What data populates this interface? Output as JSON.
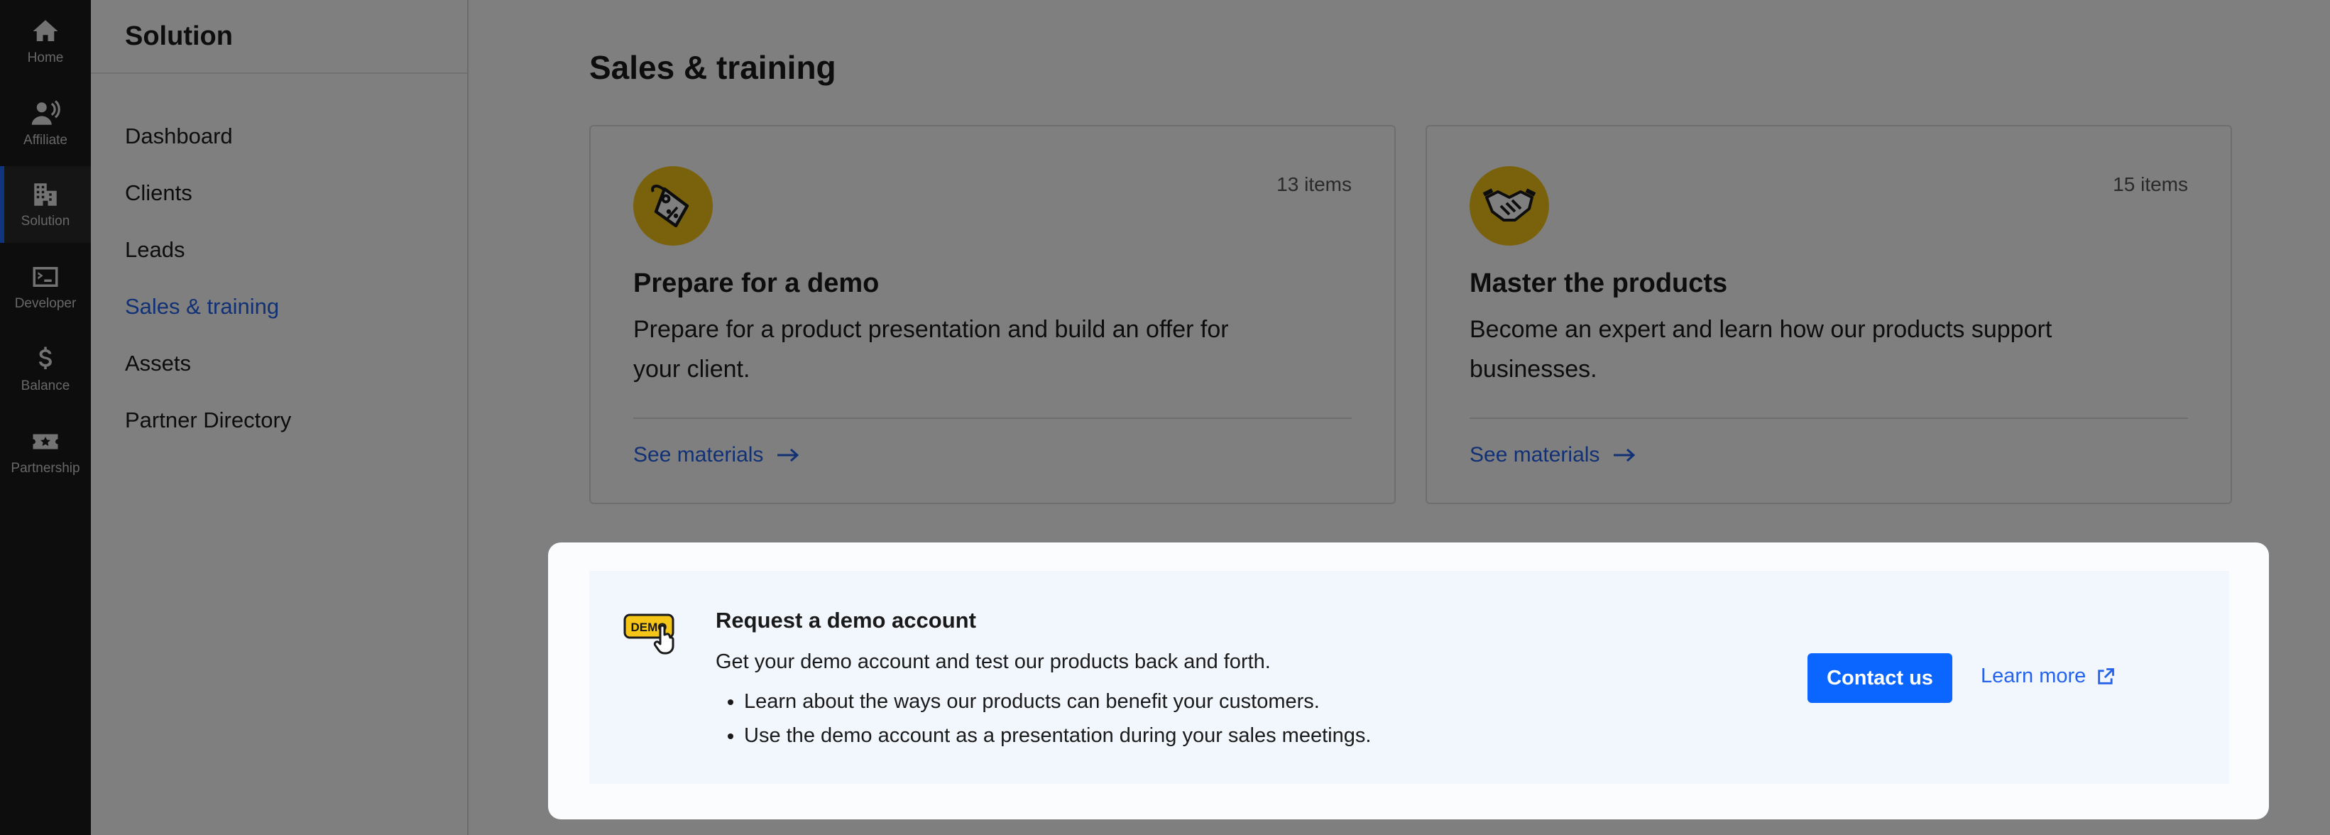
{
  "rail": {
    "items": [
      {
        "label": "Home",
        "icon": "home-icon"
      },
      {
        "label": "Affiliate",
        "icon": "affiliate-icon"
      },
      {
        "label": "Solution",
        "icon": "building-icon",
        "active": true
      },
      {
        "label": "Developer",
        "icon": "terminal-icon"
      },
      {
        "label": "Balance",
        "icon": "dollar-icon"
      },
      {
        "label": "Partnership",
        "icon": "ticket-icon"
      }
    ]
  },
  "sidebar": {
    "title": "Solution",
    "items": [
      {
        "label": "Dashboard"
      },
      {
        "label": "Clients"
      },
      {
        "label": "Leads"
      },
      {
        "label": "Sales & training",
        "active": true
      },
      {
        "label": "Assets"
      },
      {
        "label": "Partner Directory"
      }
    ]
  },
  "main": {
    "title": "Sales & training",
    "cards": [
      {
        "icon": "price-tag-icon",
        "count": "13 items",
        "title": "Prepare for a demo",
        "description": "Prepare for a product presentation and build an offer for your client.",
        "link": "See materials"
      },
      {
        "icon": "handshake-icon",
        "count": "15 items",
        "title": "Master the products",
        "description": "Become an expert and learn how our products support businesses.",
        "link": "See materials"
      }
    ]
  },
  "banner": {
    "icon": "demo-icon",
    "icon_text": "DEMO",
    "title": "Request a demo account",
    "description": "Get your demo account and test our products back and forth.",
    "bullets": [
      "Learn about the ways our products can benefit your customers.",
      "Use the demo account as a presentation during your sales meetings."
    ],
    "primary_button": "Contact us",
    "secondary_link": "Learn more"
  },
  "colors": {
    "accent": "#0a66ff",
    "link": "#2563eb",
    "icon_yellow": "#f5c518",
    "rail_bg": "#1b1b1b"
  }
}
